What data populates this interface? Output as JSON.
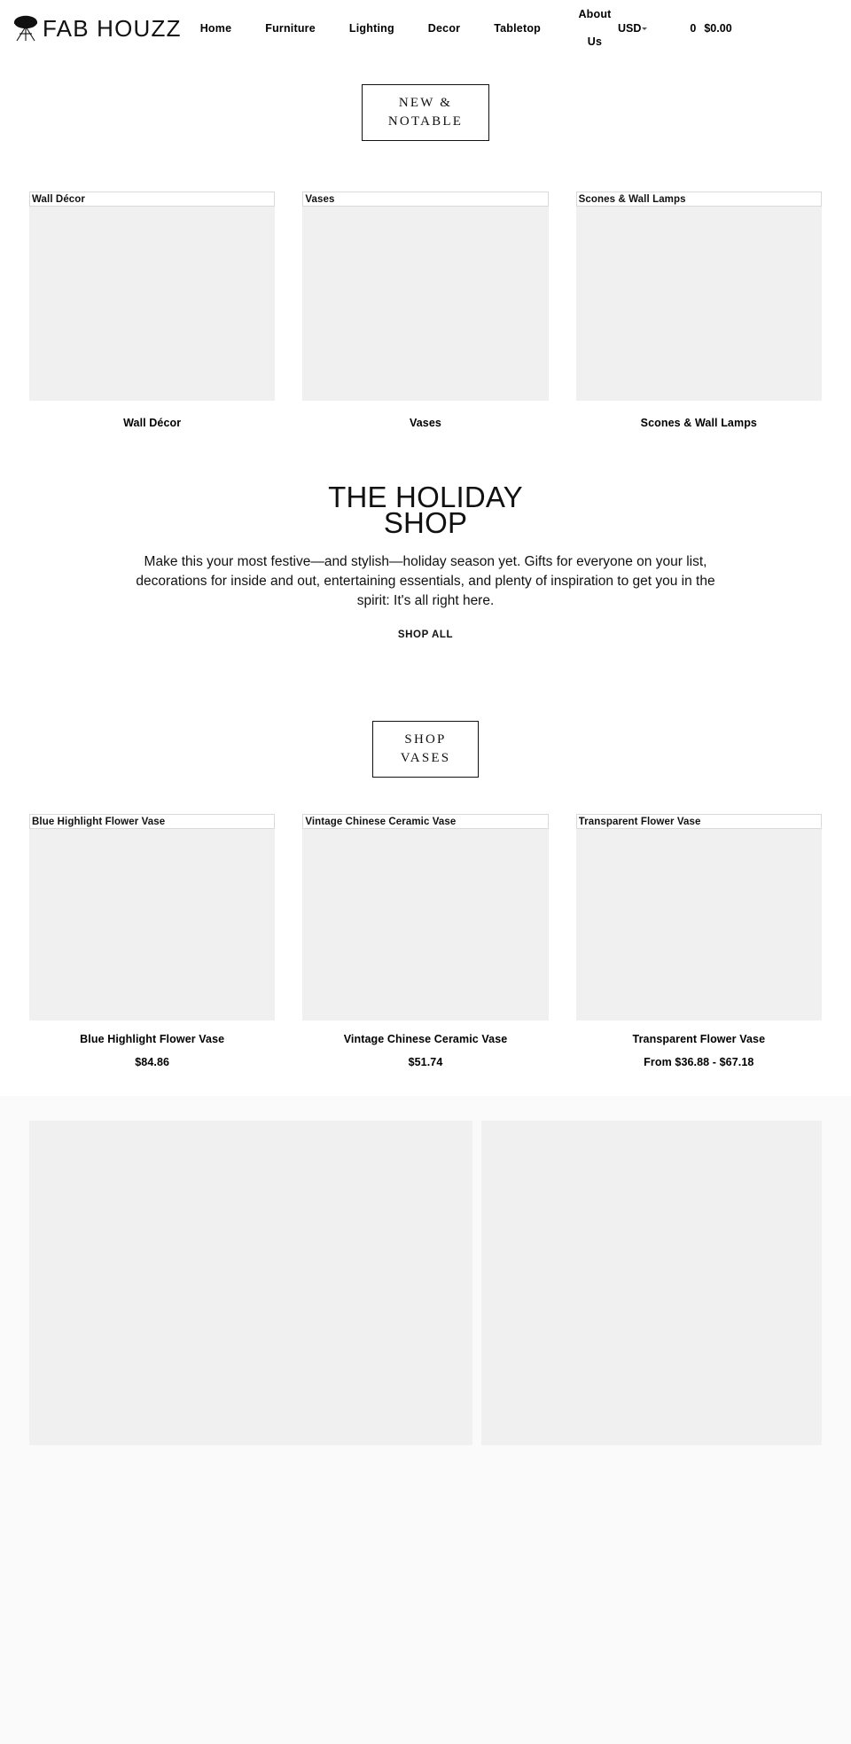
{
  "header": {
    "brand_name": "FAB HOUZZ",
    "logo_icon": "chair-logo-icon",
    "nav": [
      {
        "label": "Home"
      },
      {
        "label": "Furniture"
      },
      {
        "label": "Lighting"
      },
      {
        "label": "Decor"
      },
      {
        "label": "Tabletop"
      },
      {
        "label": "About Us"
      }
    ],
    "currency": {
      "label": "USD",
      "icon": "chevron-down-icon"
    },
    "cart": {
      "count": "0",
      "total": "$0.00"
    }
  },
  "new_notable": {
    "button_label": "NEW & NOTABLE"
  },
  "categories": [
    {
      "alt": "Wall Décor",
      "caption": "Wall Décor"
    },
    {
      "alt": "Vases",
      "caption": "Vases"
    },
    {
      "alt": "Scones & Wall Lamps",
      "caption": "Scones & Wall Lamps"
    }
  ],
  "holiday": {
    "title_line1": "THE HOLIDAY",
    "title_line2": "SHOP",
    "body": "Make this your most festive—and stylish—holiday season yet. Gifts for everyone on your list, decorations for inside and out, entertaining essentials, and plenty of inspiration to get you in the spirit: It's all right here.",
    "cta": "SHOP ALL"
  },
  "shop_vases": {
    "button_line1": "SHOP",
    "button_line2": "VASES"
  },
  "products": [
    {
      "alt": "Blue Highlight Flower Vase",
      "title": "Blue Highlight Flower Vase",
      "price": "$84.86"
    },
    {
      "alt": "Vintage Chinese Ceramic Vase",
      "title": "Vintage Chinese Ceramic Vase",
      "price": "$51.74"
    },
    {
      "alt": "Transparent Flower Vase",
      "title": "Transparent Flower Vase",
      "price": "From $36.88 - $67.18"
    }
  ],
  "colors": {
    "page_background": "#ffffff",
    "placeholder": "#f0f0f0",
    "band_background": "#fafafa",
    "text": "#000000",
    "border": "#111111"
  }
}
